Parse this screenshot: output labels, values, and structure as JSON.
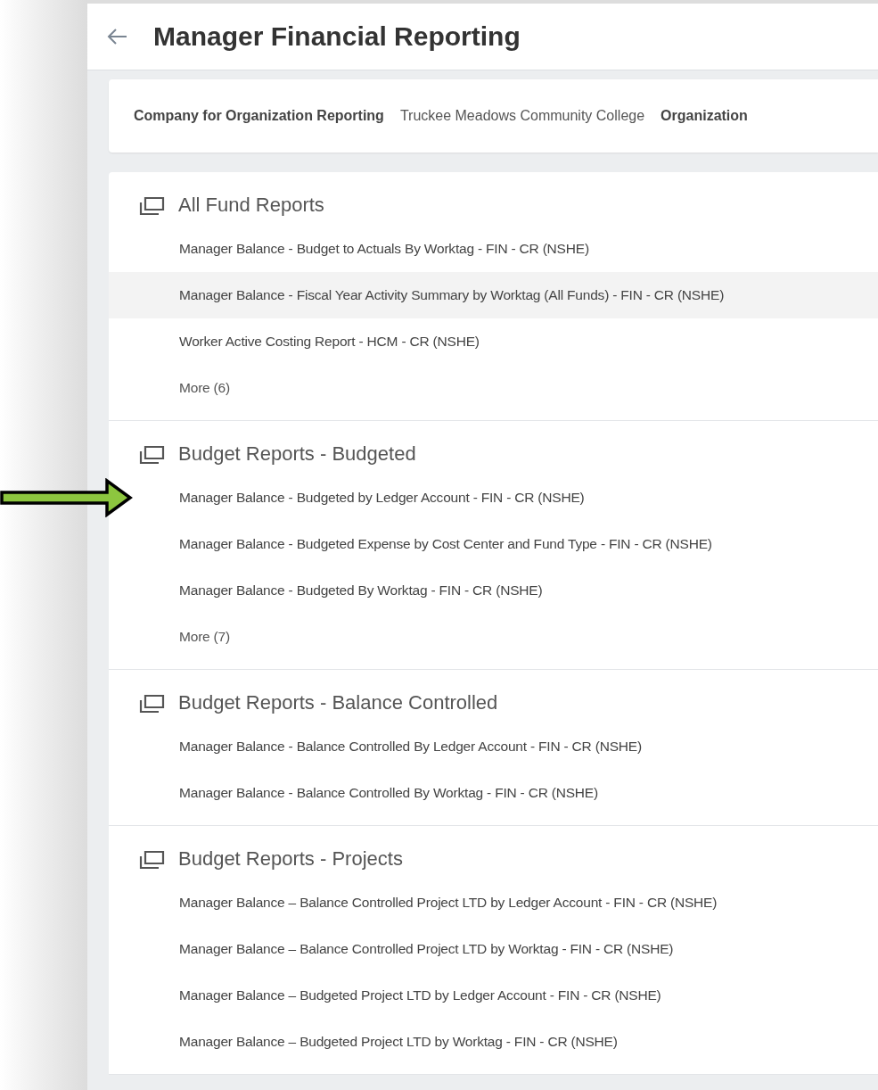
{
  "header": {
    "title": "Manager Financial Reporting"
  },
  "filters": [
    {
      "kind": "label",
      "text": "Company for Organization Reporting"
    },
    {
      "kind": "value",
      "text": "Truckee Meadows Community College"
    },
    {
      "kind": "label",
      "text": "Organization"
    }
  ],
  "sections": [
    {
      "title": "All Fund Reports",
      "items": [
        {
          "kind": "report",
          "label": "Manager Balance - Budget to Actuals By Worktag - FIN - CR (NSHE)",
          "highlighted": false,
          "pointed": false
        },
        {
          "kind": "report",
          "label": "Manager Balance - Fiscal Year Activity Summary by Worktag (All Funds) - FIN - CR (NSHE)",
          "highlighted": true,
          "pointed": false
        },
        {
          "kind": "report",
          "label": "Worker Active Costing Report - HCM - CR (NSHE)",
          "highlighted": false,
          "pointed": false
        },
        {
          "kind": "more",
          "label": "More (6)",
          "highlighted": false,
          "pointed": false
        }
      ]
    },
    {
      "title": "Budget Reports - Budgeted",
      "items": [
        {
          "kind": "report",
          "label": "Manager Balance - Budgeted by Ledger Account - FIN - CR (NSHE)",
          "highlighted": false,
          "pointed": true
        },
        {
          "kind": "report",
          "label": "Manager Balance - Budgeted Expense by Cost Center and Fund Type - FIN - CR (NSHE)",
          "highlighted": false,
          "pointed": false
        },
        {
          "kind": "report",
          "label": "Manager Balance - Budgeted By Worktag - FIN - CR (NSHE)",
          "highlighted": false,
          "pointed": false
        },
        {
          "kind": "more",
          "label": "More (7)",
          "highlighted": false,
          "pointed": false
        }
      ]
    },
    {
      "title": "Budget Reports - Balance Controlled",
      "items": [
        {
          "kind": "report",
          "label": "Manager Balance - Balance Controlled By Ledger Account - FIN - CR (NSHE)",
          "highlighted": false,
          "pointed": false
        },
        {
          "kind": "report",
          "label": "Manager Balance - Balance Controlled By Worktag - FIN - CR (NSHE)",
          "highlighted": false,
          "pointed": false
        }
      ]
    },
    {
      "title": "Budget Reports - Projects",
      "items": [
        {
          "kind": "report",
          "label": "Manager Balance – Balance Controlled Project LTD by Ledger Account - FIN - CR (NSHE)",
          "highlighted": false,
          "pointed": false
        },
        {
          "kind": "report",
          "label": "Manager Balance – Balance Controlled Project LTD by Worktag - FIN - CR (NSHE)",
          "highlighted": false,
          "pointed": false
        },
        {
          "kind": "report",
          "label": "Manager Balance – Budgeted Project LTD by Ledger Account - FIN - CR (NSHE)",
          "highlighted": false,
          "pointed": false
        },
        {
          "kind": "report",
          "label": "Manager Balance – Budgeted Project LTD by Worktag - FIN - CR (NSHE)",
          "highlighted": false,
          "pointed": false
        }
      ]
    }
  ]
}
